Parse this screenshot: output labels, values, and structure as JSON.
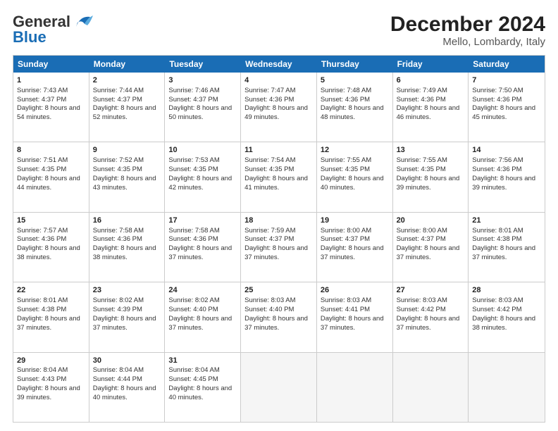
{
  "header": {
    "logo_line1": "General",
    "logo_line2": "Blue",
    "title": "December 2024",
    "subtitle": "Mello, Lombardy, Italy"
  },
  "calendar": {
    "days_of_week": [
      "Sunday",
      "Monday",
      "Tuesday",
      "Wednesday",
      "Thursday",
      "Friday",
      "Saturday"
    ],
    "rows": [
      [
        {
          "day": "1",
          "sunrise": "Sunrise: 7:43 AM",
          "sunset": "Sunset: 4:37 PM",
          "daylight": "Daylight: 8 hours and 54 minutes."
        },
        {
          "day": "2",
          "sunrise": "Sunrise: 7:44 AM",
          "sunset": "Sunset: 4:37 PM",
          "daylight": "Daylight: 8 hours and 52 minutes."
        },
        {
          "day": "3",
          "sunrise": "Sunrise: 7:46 AM",
          "sunset": "Sunset: 4:37 PM",
          "daylight": "Daylight: 8 hours and 50 minutes."
        },
        {
          "day": "4",
          "sunrise": "Sunrise: 7:47 AM",
          "sunset": "Sunset: 4:36 PM",
          "daylight": "Daylight: 8 hours and 49 minutes."
        },
        {
          "day": "5",
          "sunrise": "Sunrise: 7:48 AM",
          "sunset": "Sunset: 4:36 PM",
          "daylight": "Daylight: 8 hours and 48 minutes."
        },
        {
          "day": "6",
          "sunrise": "Sunrise: 7:49 AM",
          "sunset": "Sunset: 4:36 PM",
          "daylight": "Daylight: 8 hours and 46 minutes."
        },
        {
          "day": "7",
          "sunrise": "Sunrise: 7:50 AM",
          "sunset": "Sunset: 4:36 PM",
          "daylight": "Daylight: 8 hours and 45 minutes."
        }
      ],
      [
        {
          "day": "8",
          "sunrise": "Sunrise: 7:51 AM",
          "sunset": "Sunset: 4:35 PM",
          "daylight": "Daylight: 8 hours and 44 minutes."
        },
        {
          "day": "9",
          "sunrise": "Sunrise: 7:52 AM",
          "sunset": "Sunset: 4:35 PM",
          "daylight": "Daylight: 8 hours and 43 minutes."
        },
        {
          "day": "10",
          "sunrise": "Sunrise: 7:53 AM",
          "sunset": "Sunset: 4:35 PM",
          "daylight": "Daylight: 8 hours and 42 minutes."
        },
        {
          "day": "11",
          "sunrise": "Sunrise: 7:54 AM",
          "sunset": "Sunset: 4:35 PM",
          "daylight": "Daylight: 8 hours and 41 minutes."
        },
        {
          "day": "12",
          "sunrise": "Sunrise: 7:55 AM",
          "sunset": "Sunset: 4:35 PM",
          "daylight": "Daylight: 8 hours and 40 minutes."
        },
        {
          "day": "13",
          "sunrise": "Sunrise: 7:55 AM",
          "sunset": "Sunset: 4:35 PM",
          "daylight": "Daylight: 8 hours and 39 minutes."
        },
        {
          "day": "14",
          "sunrise": "Sunrise: 7:56 AM",
          "sunset": "Sunset: 4:36 PM",
          "daylight": "Daylight: 8 hours and 39 minutes."
        }
      ],
      [
        {
          "day": "15",
          "sunrise": "Sunrise: 7:57 AM",
          "sunset": "Sunset: 4:36 PM",
          "daylight": "Daylight: 8 hours and 38 minutes."
        },
        {
          "day": "16",
          "sunrise": "Sunrise: 7:58 AM",
          "sunset": "Sunset: 4:36 PM",
          "daylight": "Daylight: 8 hours and 38 minutes."
        },
        {
          "day": "17",
          "sunrise": "Sunrise: 7:58 AM",
          "sunset": "Sunset: 4:36 PM",
          "daylight": "Daylight: 8 hours and 37 minutes."
        },
        {
          "day": "18",
          "sunrise": "Sunrise: 7:59 AM",
          "sunset": "Sunset: 4:37 PM",
          "daylight": "Daylight: 8 hours and 37 minutes."
        },
        {
          "day": "19",
          "sunrise": "Sunrise: 8:00 AM",
          "sunset": "Sunset: 4:37 PM",
          "daylight": "Daylight: 8 hours and 37 minutes."
        },
        {
          "day": "20",
          "sunrise": "Sunrise: 8:00 AM",
          "sunset": "Sunset: 4:37 PM",
          "daylight": "Daylight: 8 hours and 37 minutes."
        },
        {
          "day": "21",
          "sunrise": "Sunrise: 8:01 AM",
          "sunset": "Sunset: 4:38 PM",
          "daylight": "Daylight: 8 hours and 37 minutes."
        }
      ],
      [
        {
          "day": "22",
          "sunrise": "Sunrise: 8:01 AM",
          "sunset": "Sunset: 4:38 PM",
          "daylight": "Daylight: 8 hours and 37 minutes."
        },
        {
          "day": "23",
          "sunrise": "Sunrise: 8:02 AM",
          "sunset": "Sunset: 4:39 PM",
          "daylight": "Daylight: 8 hours and 37 minutes."
        },
        {
          "day": "24",
          "sunrise": "Sunrise: 8:02 AM",
          "sunset": "Sunset: 4:40 PM",
          "daylight": "Daylight: 8 hours and 37 minutes."
        },
        {
          "day": "25",
          "sunrise": "Sunrise: 8:03 AM",
          "sunset": "Sunset: 4:40 PM",
          "daylight": "Daylight: 8 hours and 37 minutes."
        },
        {
          "day": "26",
          "sunrise": "Sunrise: 8:03 AM",
          "sunset": "Sunset: 4:41 PM",
          "daylight": "Daylight: 8 hours and 37 minutes."
        },
        {
          "day": "27",
          "sunrise": "Sunrise: 8:03 AM",
          "sunset": "Sunset: 4:42 PM",
          "daylight": "Daylight: 8 hours and 37 minutes."
        },
        {
          "day": "28",
          "sunrise": "Sunrise: 8:03 AM",
          "sunset": "Sunset: 4:42 PM",
          "daylight": "Daylight: 8 hours and 38 minutes."
        }
      ],
      [
        {
          "day": "29",
          "sunrise": "Sunrise: 8:04 AM",
          "sunset": "Sunset: 4:43 PM",
          "daylight": "Daylight: 8 hours and 39 minutes."
        },
        {
          "day": "30",
          "sunrise": "Sunrise: 8:04 AM",
          "sunset": "Sunset: 4:44 PM",
          "daylight": "Daylight: 8 hours and 40 minutes."
        },
        {
          "day": "31",
          "sunrise": "Sunrise: 8:04 AM",
          "sunset": "Sunset: 4:45 PM",
          "daylight": "Daylight: 8 hours and 40 minutes."
        },
        null,
        null,
        null,
        null
      ]
    ]
  }
}
